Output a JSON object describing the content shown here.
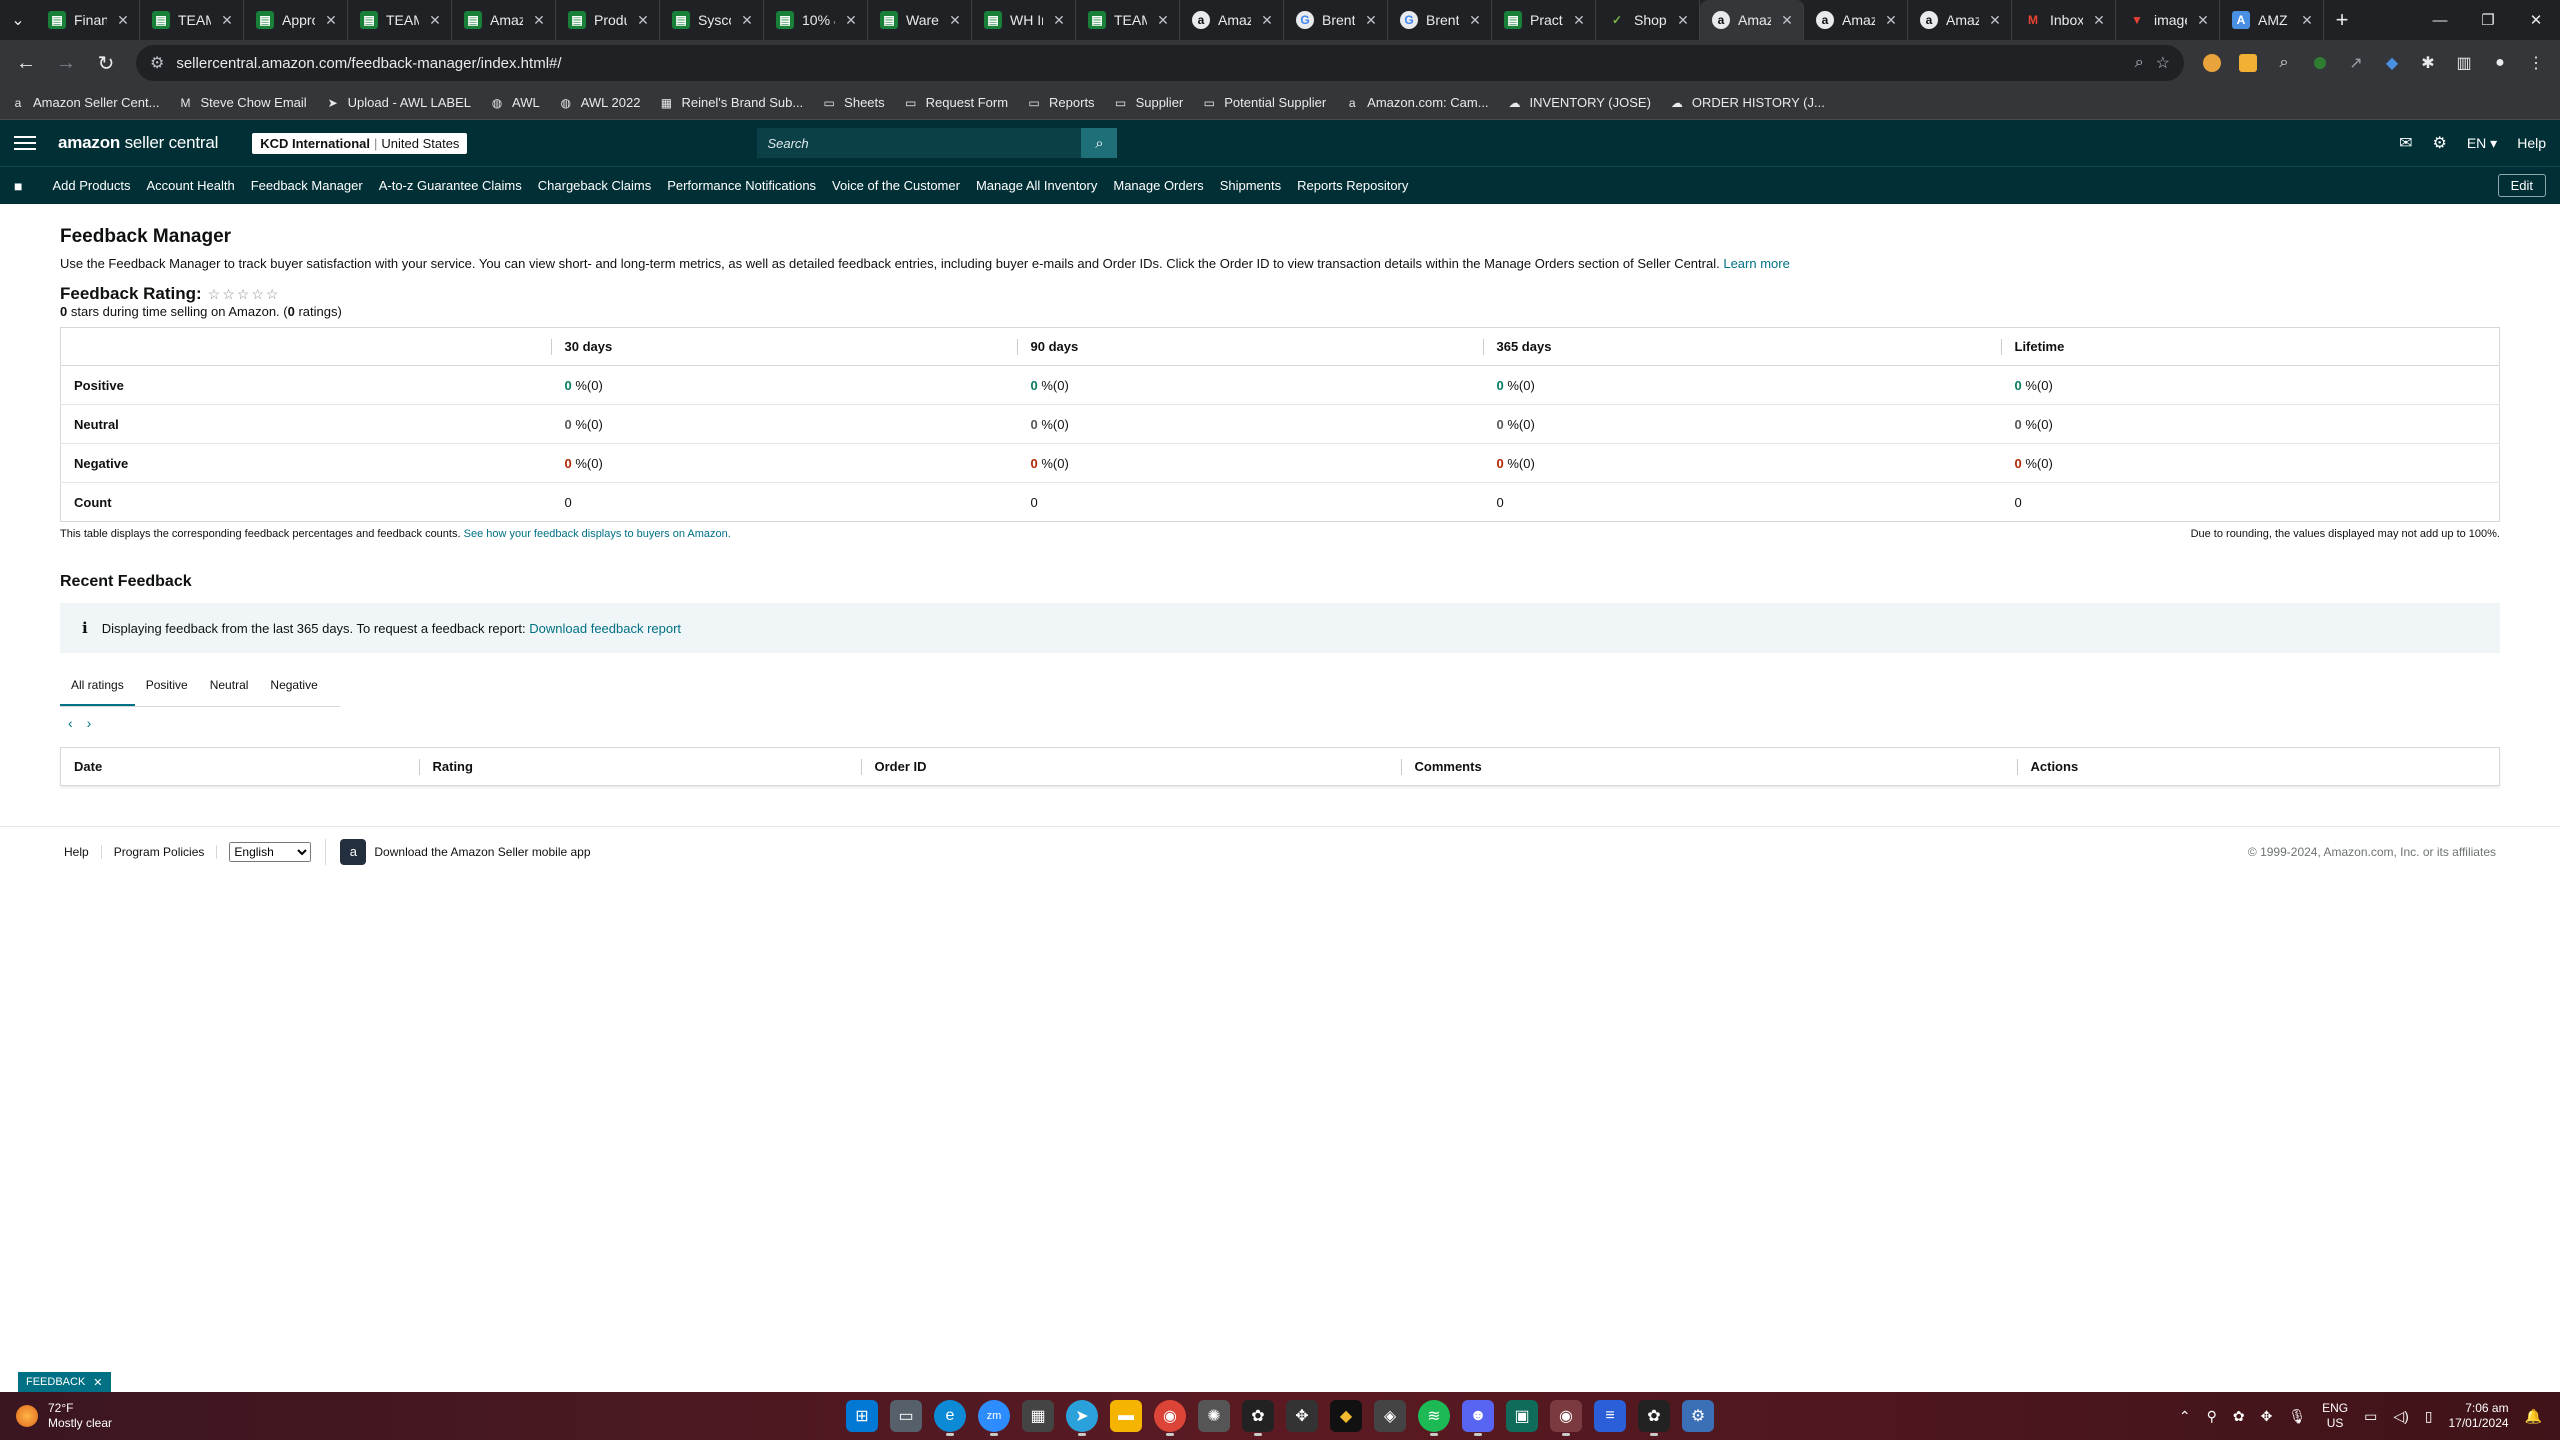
{
  "browser": {
    "tabs": [
      {
        "title": "Financ",
        "icon": "sheets-icon",
        "active": false
      },
      {
        "title": "TEAM",
        "icon": "sheets-icon",
        "active": false
      },
      {
        "title": "Appro",
        "icon": "sheets-icon",
        "active": false
      },
      {
        "title": "TEAM",
        "icon": "sheets-icon",
        "active": false
      },
      {
        "title": "Amaz",
        "icon": "sheets-icon",
        "active": false
      },
      {
        "title": "Produ",
        "icon": "sheets-icon",
        "active": false
      },
      {
        "title": "Sysco",
        "icon": "sheets-icon",
        "active": false
      },
      {
        "title": "10% &",
        "icon": "sheets-icon",
        "active": false
      },
      {
        "title": "Wareh",
        "icon": "sheets-icon",
        "active": false
      },
      {
        "title": "WH In",
        "icon": "sheets-icon",
        "active": false
      },
      {
        "title": "TEAM",
        "icon": "sheets-icon",
        "active": false
      },
      {
        "title": "Amaz",
        "icon": "amazon-icon",
        "active": false
      },
      {
        "title": "Brent",
        "icon": "google-icon",
        "active": false
      },
      {
        "title": "Brent",
        "icon": "google-icon",
        "active": false
      },
      {
        "title": "Practi",
        "icon": "sheets-icon",
        "active": false
      },
      {
        "title": "Shop",
        "icon": "shop-icon",
        "active": false
      },
      {
        "title": "Amaz",
        "icon": "amazon-icon",
        "active": true
      },
      {
        "title": "Amaz",
        "icon": "amazon-icon",
        "active": false
      },
      {
        "title": "Amaz",
        "icon": "amazon-icon",
        "active": false
      },
      {
        "title": "Inbox",
        "icon": "gmail-icon",
        "active": false
      },
      {
        "title": "image",
        "icon": "image-icon",
        "active": false
      },
      {
        "title": "AMZ I",
        "icon": "amz-icon",
        "active": false
      }
    ],
    "url": "sellercentral.amazon.com/feedback-manager/index.html#/",
    "bookmarks": [
      {
        "label": "Amazon Seller Cent...",
        "icon": "amazon-icon"
      },
      {
        "label": "Steve Chow Email",
        "icon": "gmail-icon"
      },
      {
        "label": "Upload - AWL LABEL",
        "icon": "upload-icon"
      },
      {
        "label": "AWL",
        "icon": "globe-icon"
      },
      {
        "label": "AWL 2022",
        "icon": "globe-icon"
      },
      {
        "label": "Reinel's Brand Sub...",
        "icon": "page-icon"
      },
      {
        "label": "Sheets",
        "icon": "folder-icon"
      },
      {
        "label": "Request Form",
        "icon": "folder-icon"
      },
      {
        "label": "Reports",
        "icon": "folder-icon"
      },
      {
        "label": "Supplier",
        "icon": "folder-icon"
      },
      {
        "label": "Potential Supplier",
        "icon": "folder-icon"
      },
      {
        "label": "Amazon.com: Cam...",
        "icon": "amazon-icon"
      },
      {
        "label": "INVENTORY (JOSE)",
        "icon": "cloud-icon"
      },
      {
        "label": "ORDER HISTORY (J...",
        "icon": "cloud-icon"
      }
    ]
  },
  "seller_central": {
    "logo_bold": "amazon",
    "logo_light": " seller central",
    "account_name": "KCD International",
    "account_region": "United States",
    "search_placeholder": "Search",
    "language": "EN",
    "help": "Help",
    "nav_items": [
      "Add Products",
      "Account Health",
      "Feedback Manager",
      "A-to-z Guarantee Claims",
      "Chargeback Claims",
      "Performance Notifications",
      "Voice of the Customer",
      "Manage All Inventory",
      "Manage Orders",
      "Shipments",
      "Reports Repository"
    ],
    "edit_label": "Edit"
  },
  "page": {
    "title": "Feedback Manager",
    "intro": "Use the Feedback Manager to track buyer satisfaction with your service. You can view short- and long-term metrics, as well as detailed feedback entries, including buyer e-mails and Order IDs. Click the Order ID to view transaction details within the Manage Orders section of Seller Central.",
    "learn_more": "Learn more",
    "rating_label": "Feedback Rating:",
    "stars_count": "0",
    "stars_text": " stars during time selling on Amazon. (",
    "ratings_count": "0",
    "ratings_text": " ratings)",
    "table": {
      "headers": [
        "",
        "30 days",
        "90 days",
        "365 days",
        "Lifetime"
      ],
      "rows": [
        {
          "label": "Positive",
          "kind": "pos",
          "values": [
            "0",
            "0",
            "0",
            "0"
          ],
          "suffix": " %(0)"
        },
        {
          "label": "Neutral",
          "kind": "neu",
          "values": [
            "0",
            "0",
            "0",
            "0"
          ],
          "suffix": " %(0)"
        },
        {
          "label": "Negative",
          "kind": "neg",
          "values": [
            "0",
            "0",
            "0",
            "0"
          ],
          "suffix": " %(0)"
        },
        {
          "label": "Count",
          "kind": "count",
          "values": [
            "0",
            "0",
            "0",
            "0"
          ],
          "suffix": ""
        }
      ]
    },
    "note_left": "This table displays the corresponding feedback percentages and feedback counts.",
    "note_left_link": "See how your feedback displays to buyers on Amazon.",
    "note_right": "Due to rounding, the values displayed may not add up to 100%.",
    "recent_title": "Recent Feedback",
    "info_text": "Displaying feedback from the last 365 days. To request a feedback report:",
    "info_link": "Download feedback report",
    "rating_tabs": [
      "All ratings",
      "Positive",
      "Neutral",
      "Negative"
    ],
    "recent_headers": [
      "Date",
      "Rating",
      "Order ID",
      "Comments",
      "Actions"
    ]
  },
  "footer": {
    "help": "Help",
    "program_policies": "Program Policies",
    "language_selected": "English",
    "app_download": "Download the Amazon Seller mobile app",
    "copyright": "© 1999-2024, Amazon.com, Inc. or its affiliates"
  },
  "feedback_button": "FEEDBACK",
  "taskbar": {
    "temperature": "72°F",
    "weather": "Mostly clear",
    "lang_top": "ENG",
    "lang_bottom": "US",
    "time": "7:06 am",
    "date": "17/01/2024"
  },
  "colors": {
    "seller_header": "#002f36",
    "link": "#007185",
    "positive": "#067d62",
    "negative": "#b12704"
  }
}
